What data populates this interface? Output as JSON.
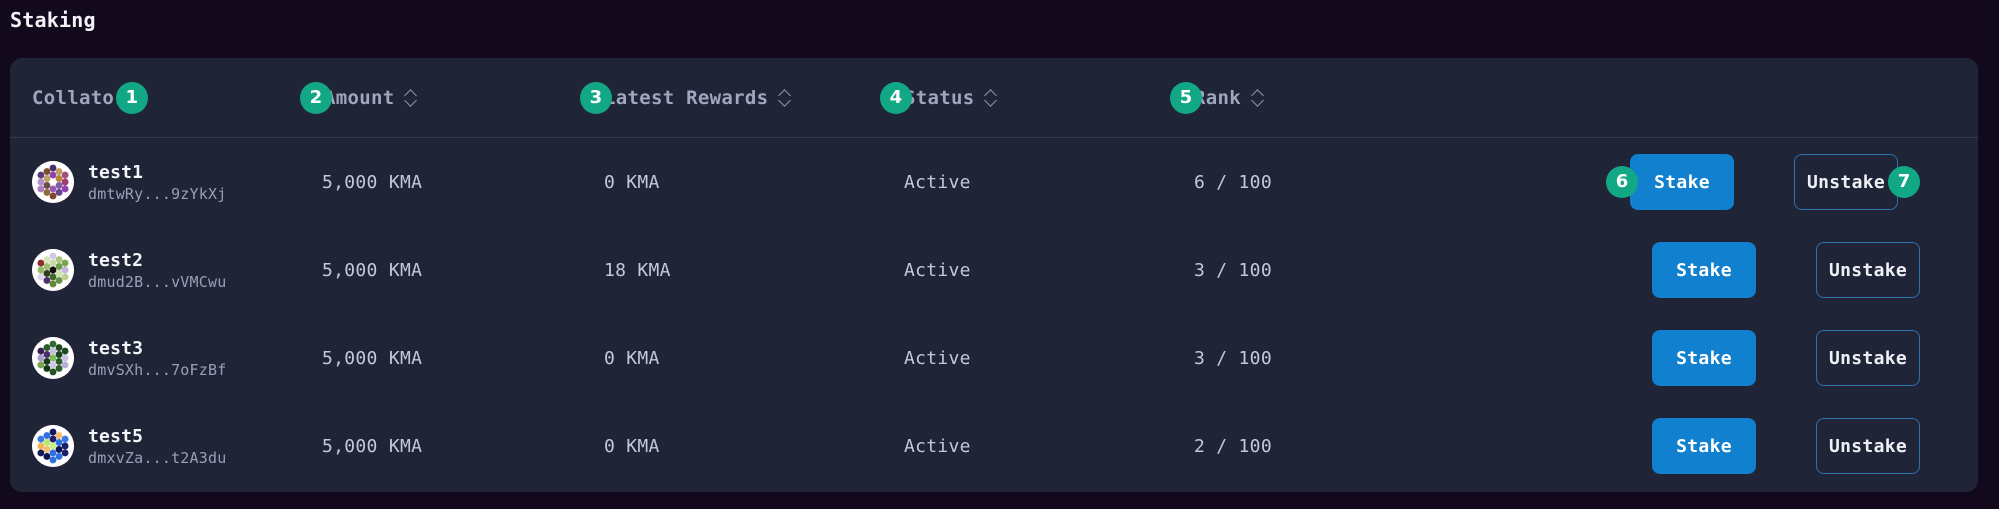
{
  "page": {
    "title": "Staking"
  },
  "table": {
    "columns": [
      {
        "key": "collator",
        "label": "Collator",
        "badge": "1",
        "badge_position": "after",
        "sortable": false
      },
      {
        "key": "amount",
        "label": "Amount",
        "badge": "2",
        "badge_position": "before",
        "sortable": true
      },
      {
        "key": "rewards",
        "label": "Latest Rewards",
        "badge": "3",
        "badge_position": "before",
        "sortable": true
      },
      {
        "key": "status",
        "label": "Status",
        "badge": "4",
        "badge_position": "before",
        "sortable": true
      },
      {
        "key": "rank",
        "label": "Rank",
        "badge": "5",
        "badge_position": "before",
        "sortable": true
      }
    ],
    "sort_icon": "sort-updown-icon",
    "rows": [
      {
        "name": "test1",
        "address": "dmtwRy...9zYkXj",
        "amount": "5,000 KMA",
        "rewards": "0 KMA",
        "status": "Active",
        "rank": "6 / 100",
        "stake_label": "Stake",
        "unstake_label": "Unstake",
        "stake_badge": "6",
        "unstake_badge": "7",
        "identicon_colors": [
          "#ffffff",
          "#8e44ad",
          "#b8863f",
          "#7d5ba6",
          "#9b59b6",
          "#6d4c41",
          "#c2a06b",
          "#4a2f6b",
          "#a0527f",
          "#8e44ad",
          "#7a4a2a",
          "#b07cc6",
          "#5d3a7a",
          "#c39b5e",
          "#9c3f6b",
          "#6a3f8f",
          "#8d6a3f",
          "#b38fcf",
          "#7b4f2d",
          "#a85f9e"
        ]
      },
      {
        "name": "test2",
        "address": "dmud2B...vVMCwu",
        "amount": "5,000 KMA",
        "rewards": "18 KMA",
        "status": "Active",
        "rank": "3 / 100",
        "stake_label": "Stake",
        "unstake_label": "Unstake",
        "stake_badge": "",
        "unstake_badge": "",
        "identicon_colors": [
          "#101010",
          "#c8dba0",
          "#6f9c4a",
          "#cfe0b2",
          "#3f6b2a",
          "#2d3d1c",
          "#9fbd73",
          "#d6c7e8",
          "#7aa34e",
          "#b9d18c",
          "#5f8a3a",
          "#e0d4ef",
          "#8b2f2f",
          "#a8c77f",
          "#c3b2dd",
          "#6b8f45",
          "#4d2f6b",
          "#97b86a",
          "#d8e3c0",
          "#7d9e55"
        ]
      },
      {
        "name": "test3",
        "address": "dmvSXh...7oFzBf",
        "amount": "5,000 KMA",
        "rewards": "0 KMA",
        "status": "Active",
        "rank": "3 / 100",
        "stake_label": "Stake",
        "unstake_label": "Unstake",
        "stake_badge": "",
        "unstake_badge": "",
        "identicon_colors": [
          "#7fbf5a",
          "#c9bfe0",
          "#1e4620",
          "#2a5c2c",
          "#d3c8e8",
          "#173d1a",
          "#4a2f6b",
          "#2f6b31",
          "#1b4a1d",
          "#b8aed6",
          "#245226",
          "#7aa34e",
          "#3a1f4f",
          "#1f4a21",
          "#cfc4e4",
          "#2c5e2e",
          "#143815",
          "#a99fd0",
          "#2a5c2c",
          "#1a4a1c"
        ]
      },
      {
        "name": "test5",
        "address": "dmxvZa...t2A3du",
        "amount": "5,000 KMA",
        "rewards": "0 KMA",
        "status": "Active",
        "rank": "2 / 100",
        "stake_label": "Stake",
        "unstake_label": "Unstake",
        "stake_badge": "",
        "unstake_badge": "",
        "identicon_colors": [
          "#c9f08a",
          "#1b1f6b",
          "#2f6fe0",
          "#0e1452",
          "#2f6fe0",
          "#f0c070",
          "#b7e86a",
          "#151a5e",
          "#3a7ae8",
          "#1b1f6b",
          "#2f6fe0",
          "#141a55",
          "#3a7ae8",
          "#f0c070",
          "#1b1f6b",
          "#2f6fe0",
          "#0e1452",
          "#f2b455",
          "#2f6fe0",
          "#1b1f6b"
        ]
      }
    ]
  },
  "colors": {
    "page_background": "#13091d",
    "card_background": "#1f2437",
    "badge": "#13a885",
    "stake_button": "#1180ce",
    "unstake_border": "#2b72ad",
    "divider": "#353b4f"
  }
}
